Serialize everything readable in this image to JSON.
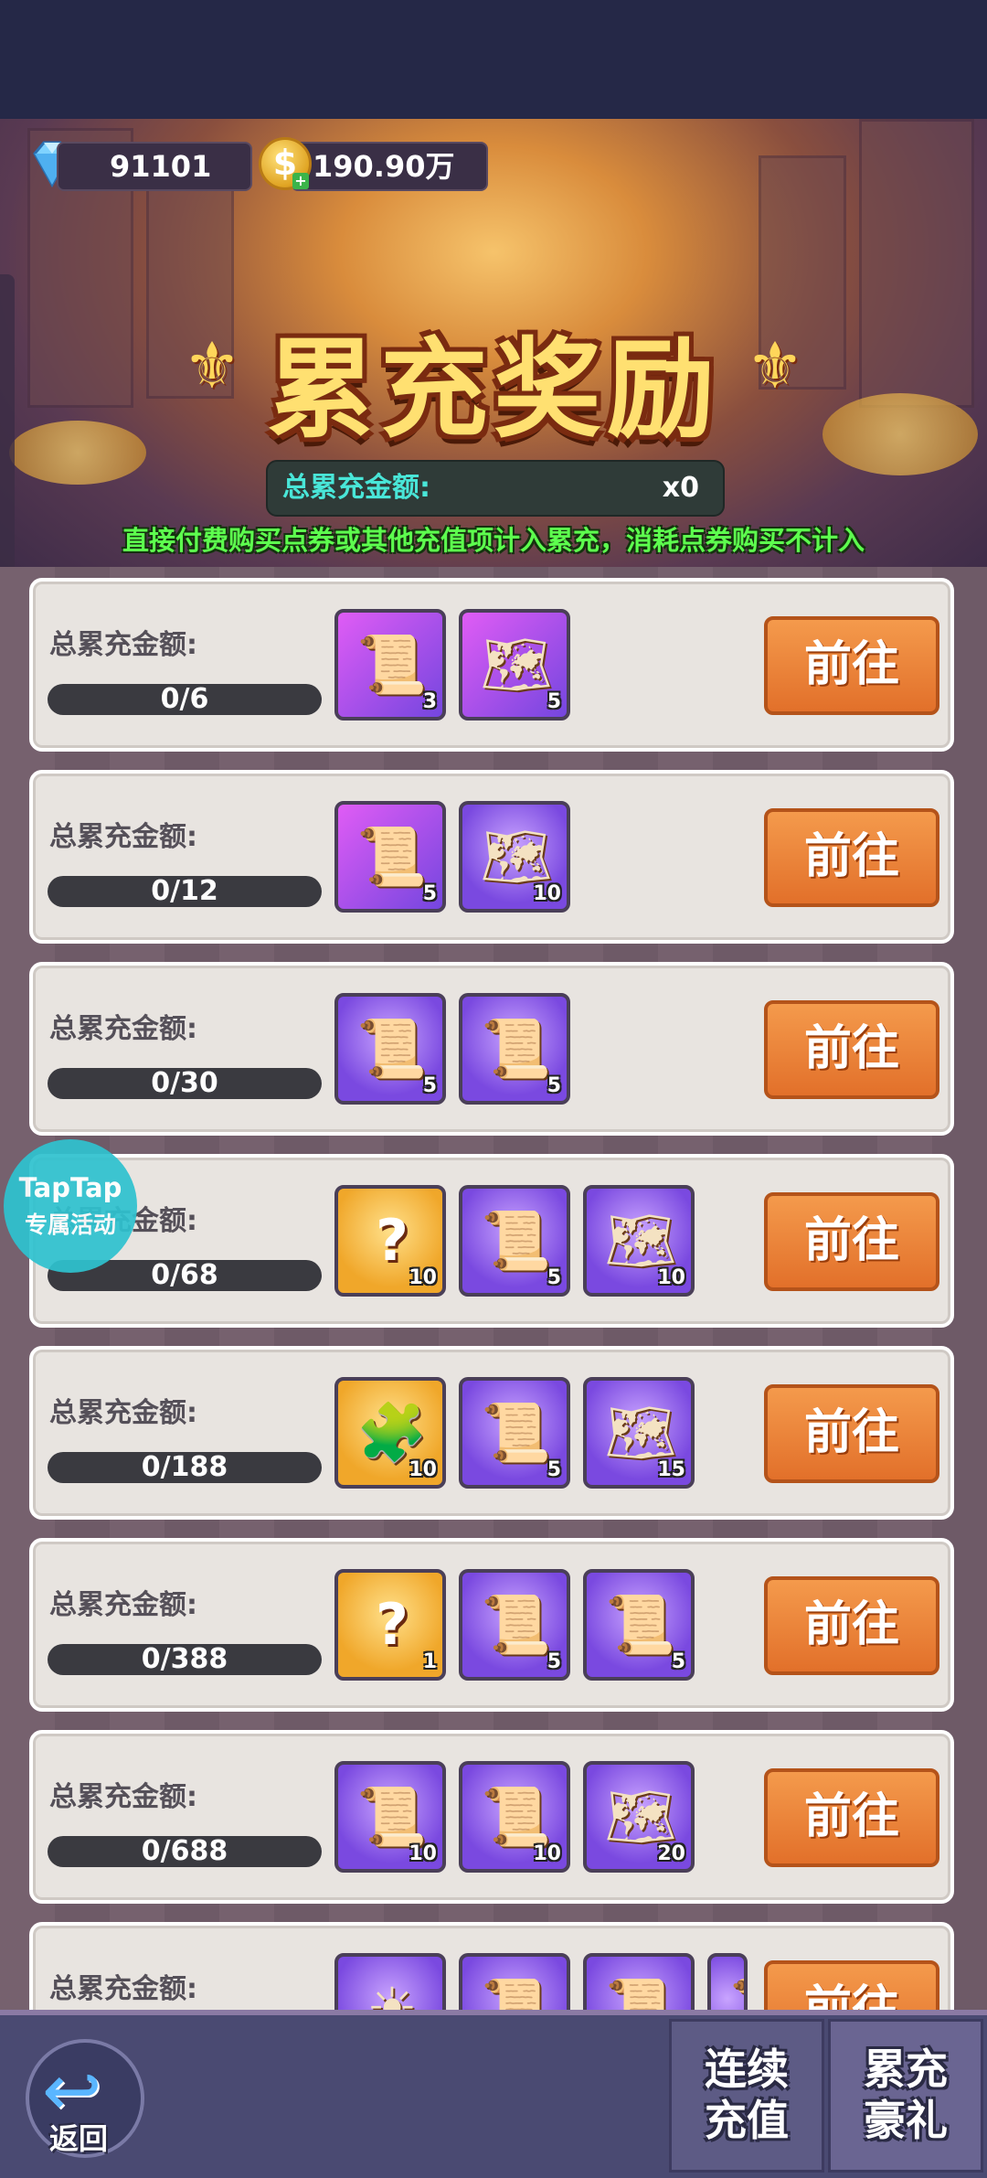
{
  "currency": {
    "gems": "91101",
    "coins": "190.90万",
    "gem_icon": "diamond-icon",
    "coin_icon": "coin-icon",
    "coin_symbol": "$"
  },
  "banner": {
    "title": "累充奖励",
    "total_label": "总累充金额:",
    "total_value": "x0",
    "notice": "直接付费购买点券或其他充值项计入累充，消耗点券购买不计入"
  },
  "tiers": [
    {
      "label": "总累充金额:",
      "progress": "0/6",
      "button": "前往",
      "rewards": [
        {
          "icon": "scroll-icon",
          "bg": "pink",
          "count": "3"
        },
        {
          "icon": "blueprint-scroll-icon",
          "bg": "pink",
          "count": "5"
        }
      ]
    },
    {
      "label": "总累充金额:",
      "progress": "0/12",
      "button": "前往",
      "rewards": [
        {
          "icon": "scroll-icon",
          "bg": "pink",
          "count": "5"
        },
        {
          "icon": "blueprint-scroll-icon",
          "bg": "purple",
          "count": "10"
        }
      ]
    },
    {
      "label": "总累充金额:",
      "progress": "0/30",
      "button": "前往",
      "rewards": [
        {
          "icon": "gem-scroll-icon",
          "bg": "purple",
          "count": "5"
        },
        {
          "icon": "scroll-icon",
          "bg": "purple",
          "count": "5"
        }
      ]
    },
    {
      "label": "总累充金额:",
      "progress": "0/68",
      "button": "前往",
      "rewards": [
        {
          "icon": "mystery-puzzle-icon",
          "bg": "gold",
          "count": "10"
        },
        {
          "icon": "scroll-icon",
          "bg": "purple",
          "count": "5"
        },
        {
          "icon": "blueprint-scroll-icon",
          "bg": "purple",
          "count": "10"
        }
      ]
    },
    {
      "label": "总累充金额:",
      "progress": "0/188",
      "button": "前往",
      "rewards": [
        {
          "icon": "puzzle-icon",
          "bg": "gold",
          "count": "10"
        },
        {
          "icon": "gem-scroll-icon",
          "bg": "purple",
          "count": "5"
        },
        {
          "icon": "blueprint-scroll-icon",
          "bg": "purple",
          "count": "15"
        }
      ]
    },
    {
      "label": "总累充金额:",
      "progress": "0/388",
      "button": "前往",
      "rewards": [
        {
          "icon": "mystery-badge-icon",
          "bg": "gold",
          "count": "1"
        },
        {
          "icon": "scroll-icon",
          "bg": "purple",
          "count": "5"
        },
        {
          "icon": "gem-scroll-icon",
          "bg": "purple",
          "count": "5"
        }
      ]
    },
    {
      "label": "总累充金额:",
      "progress": "0/688",
      "button": "前往",
      "rewards": [
        {
          "icon": "scroll-icon",
          "bg": "purple",
          "count": "10"
        },
        {
          "icon": "gem-scroll-icon",
          "bg": "purple",
          "count": "10"
        },
        {
          "icon": "blueprint-scroll-icon",
          "bg": "purple",
          "count": "20"
        }
      ]
    },
    {
      "label": "总累充金额:",
      "progress": "",
      "button": "前往",
      "rewards": [
        {
          "icon": "sun-emblem-icon",
          "bg": "purple",
          "count": ""
        },
        {
          "icon": "scroll-icon",
          "bg": "purple",
          "count": ""
        },
        {
          "icon": "gem-scroll-icon",
          "bg": "purple",
          "count": ""
        },
        {
          "icon": "scroll-icon",
          "bg": "purple",
          "count": ""
        }
      ]
    }
  ],
  "floating_badge": {
    "line1": "TapTap",
    "line2": "专属活动"
  },
  "bottom_bar": {
    "back_label": "返回",
    "back_icon": "return-arrow-icon",
    "tab1": "连续\n充值",
    "tab2": "累充\n豪礼"
  }
}
